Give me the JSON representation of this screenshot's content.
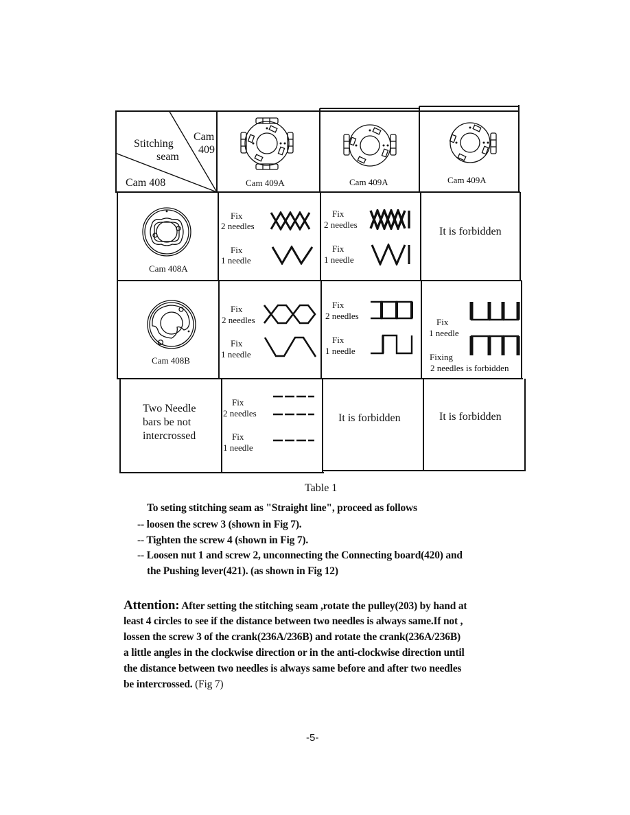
{
  "table": {
    "caption": "Table 1",
    "header": {
      "corner": {
        "stitching_seam_line1": "Stitching",
        "stitching_seam_line2": "seam",
        "cam409_line1": "Cam",
        "cam409_line2": "409",
        "cam408": "Cam 408"
      },
      "columns": [
        {
          "label": "Cam 409A",
          "icon": "cam-409a-full-segments-icon"
        },
        {
          "label": "Cam 409A",
          "icon": "cam-409a-side-segments-icon"
        },
        {
          "label": "Cam 409A",
          "icon": "cam-409a-right-segment-icon"
        }
      ]
    },
    "rows": [
      {
        "label": "Cam 408A",
        "icon": "cam-408a-icon",
        "cells": [
          {
            "type": "patterns",
            "entries": [
              {
                "fix": "Fix",
                "needles": "2 needles",
                "pattern": "cross-zigzag-pattern"
              },
              {
                "fix": "Fix",
                "needles": "1 needle",
                "pattern": "zigzag-pattern"
              }
            ]
          },
          {
            "type": "patterns",
            "entries": [
              {
                "fix": "Fix",
                "needles": "2 needles",
                "pattern": "dense-cross-zigzag-pattern"
              },
              {
                "fix": "Fix",
                "needles": "1 needle",
                "pattern": "dense-zigzag-pattern"
              }
            ]
          },
          {
            "type": "text",
            "text": "It is forbidden"
          }
        ]
      },
      {
        "label": "Cam 408B",
        "icon": "cam-408b-icon",
        "cells": [
          {
            "type": "patterns",
            "entries": [
              {
                "fix": "Fix",
                "needles": "2 needles",
                "pattern": "trapezoid-cross-pattern"
              },
              {
                "fix": "Fix",
                "needles": "1 needle",
                "pattern": "trapezoid-wave-pattern"
              }
            ]
          },
          {
            "type": "patterns",
            "entries": [
              {
                "fix": "Fix",
                "needles": "2 needles",
                "pattern": "box-chain-pattern"
              },
              {
                "fix": "Fix",
                "needles": "1 needle",
                "pattern": "square-wave-pattern"
              }
            ]
          },
          {
            "type": "special",
            "fix": "Fix",
            "needles": "1 needle",
            "note_line1": "Fixing",
            "note_line2": "2 needles is forbidden",
            "patterns": [
              "u-step-pattern",
              "inverted-u-step-pattern"
            ]
          }
        ]
      },
      {
        "label_line1": "Two Needle",
        "label_line2": "bars be not",
        "label_line3": "intercrossed",
        "cells": [
          {
            "type": "patterns",
            "entries": [
              {
                "fix": "Fix",
                "needles": "2 needles",
                "pattern": "double-straight-pattern"
              },
              {
                "fix": "Fix",
                "needles": "1 needle",
                "pattern": "straight-pattern"
              }
            ]
          },
          {
            "type": "text",
            "text": "It is forbidden"
          },
          {
            "type": "text",
            "text": "It is forbidden"
          }
        ]
      }
    ]
  },
  "instructions": {
    "intro": "To  seting stitching seam as \"Straight line\", proceed as follows",
    "steps": [
      "-- loosen the screw 3 (shown in Fig 7).",
      "-- Tighten the screw 4 (shown in Fig 7).",
      "-- Loosen nut 1 and screw 2, unconnecting the Connecting board(420) and",
      "the Pushing lever(421). (as shown in Fig 12)"
    ]
  },
  "attention": {
    "label": "Attention:",
    "lines": [
      " After setting the stitching seam ,rotate the pulley(203) by hand at",
      "least 4 circles to see if the distance between two needles is always  same.If not ,",
      "lossen the screw 3 of the crank(236A/236B) and rotate the crank(236A/236B)",
      "a little angles in the clockwise direction or in the anti-clockwise direction until",
      "the distance between two needles is always same before and after two needles",
      "be intercrossed."
    ],
    "tail": " (Fig 7)"
  },
  "page_number": "-5-"
}
